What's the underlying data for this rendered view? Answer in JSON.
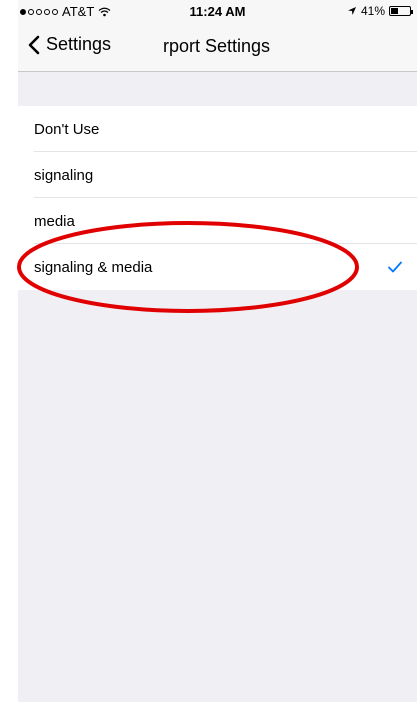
{
  "status_bar": {
    "carrier": "AT&T",
    "time": "11:24 AM",
    "battery": "41%",
    "battery_level": 0.41
  },
  "nav": {
    "back_label": "Settings",
    "title": "rport Settings"
  },
  "options": [
    {
      "label": "Don't Use",
      "selected": false
    },
    {
      "label": "signaling",
      "selected": false
    },
    {
      "label": "media",
      "selected": false
    },
    {
      "label": "signaling & media",
      "selected": true
    }
  ],
  "colors": {
    "accent": "#007aff",
    "annotation": "#e00000"
  }
}
